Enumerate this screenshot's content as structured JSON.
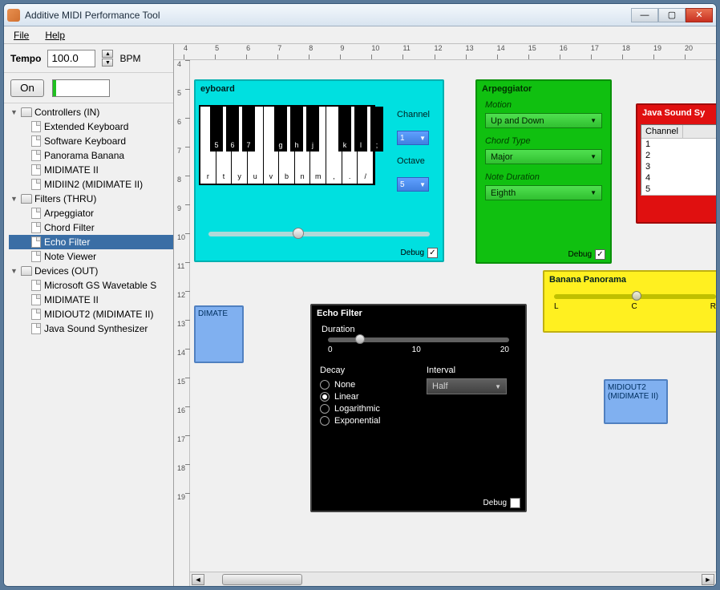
{
  "window": {
    "title": "Additive MIDI Performance Tool"
  },
  "menu": {
    "file": "File",
    "help": "Help"
  },
  "tempo": {
    "label": "Tempo",
    "value": "100.0",
    "unit": "BPM"
  },
  "on_button": "On",
  "tree": {
    "controllers": {
      "label": "Controllers (IN)",
      "items": [
        "Extended Keyboard",
        "Software Keyboard",
        "Panorama Banana",
        "MIDIMATE II",
        "MIDIIN2 (MIDIMATE II)"
      ]
    },
    "filters": {
      "label": "Filters (THRU)",
      "items": [
        "Arpeggiator",
        "Chord Filter",
        "Echo Filter",
        "Note Viewer"
      ]
    },
    "devices": {
      "label": "Devices (OUT)",
      "items": [
        "Microsoft GS Wavetable S",
        "MIDIMATE II",
        "MIDIOUT2 (MIDIMATE II)",
        "Java Sound Synthesizer"
      ]
    },
    "selected": "Echo Filter"
  },
  "ruler_h": [
    "4",
    "5",
    "6",
    "7",
    "8",
    "9",
    "10",
    "11",
    "12",
    "13",
    "14",
    "15",
    "16",
    "17",
    "18",
    "19",
    "20"
  ],
  "ruler_v": [
    "4",
    "5",
    "6",
    "7",
    "8",
    "9",
    "10",
    "11",
    "12",
    "13",
    "14",
    "15",
    "16",
    "17",
    "18",
    "19"
  ],
  "keyboard": {
    "title": "eyboard",
    "white_keys": [
      "r",
      "t",
      "y",
      "u",
      "v",
      "b",
      "n",
      "m",
      ",",
      ".",
      "/"
    ],
    "black_keys": [
      "5",
      "6",
      "7",
      "",
      "g",
      "h",
      "j",
      "",
      "k",
      "l",
      ";"
    ],
    "channel_label": "Channel",
    "channel_value": "1",
    "octave_label": "Octave",
    "octave_value": "5",
    "debug": "Debug"
  },
  "arp": {
    "title": "Arpeggiator",
    "motion_label": "Motion",
    "motion_value": "Up and Down",
    "chord_label": "Chord Type",
    "chord_value": "Major",
    "duration_label": "Note Duration",
    "duration_value": "Eighth",
    "debug": "Debug"
  },
  "jss": {
    "title": "Java Sound Sy",
    "col_channel": "Channel",
    "rows": [
      "1",
      "2",
      "3",
      "4",
      "5"
    ]
  },
  "midimate": {
    "title": "DIMATE"
  },
  "echo": {
    "title": "Echo Filter",
    "duration_label": "Duration",
    "ticks": [
      "0",
      "10",
      "20"
    ],
    "decay_label": "Decay",
    "interval_label": "Interval",
    "interval_value": "Half",
    "decay_options": [
      "None",
      "Linear",
      "Logarithmic",
      "Exponential"
    ],
    "decay_selected": "Linear",
    "debug": "Debug"
  },
  "banana": {
    "title": "Banana Panorama",
    "ticks": [
      "L",
      "C",
      "R"
    ]
  },
  "midiout": {
    "title": "MIDIOUT2 (MIDIMATE II)"
  }
}
